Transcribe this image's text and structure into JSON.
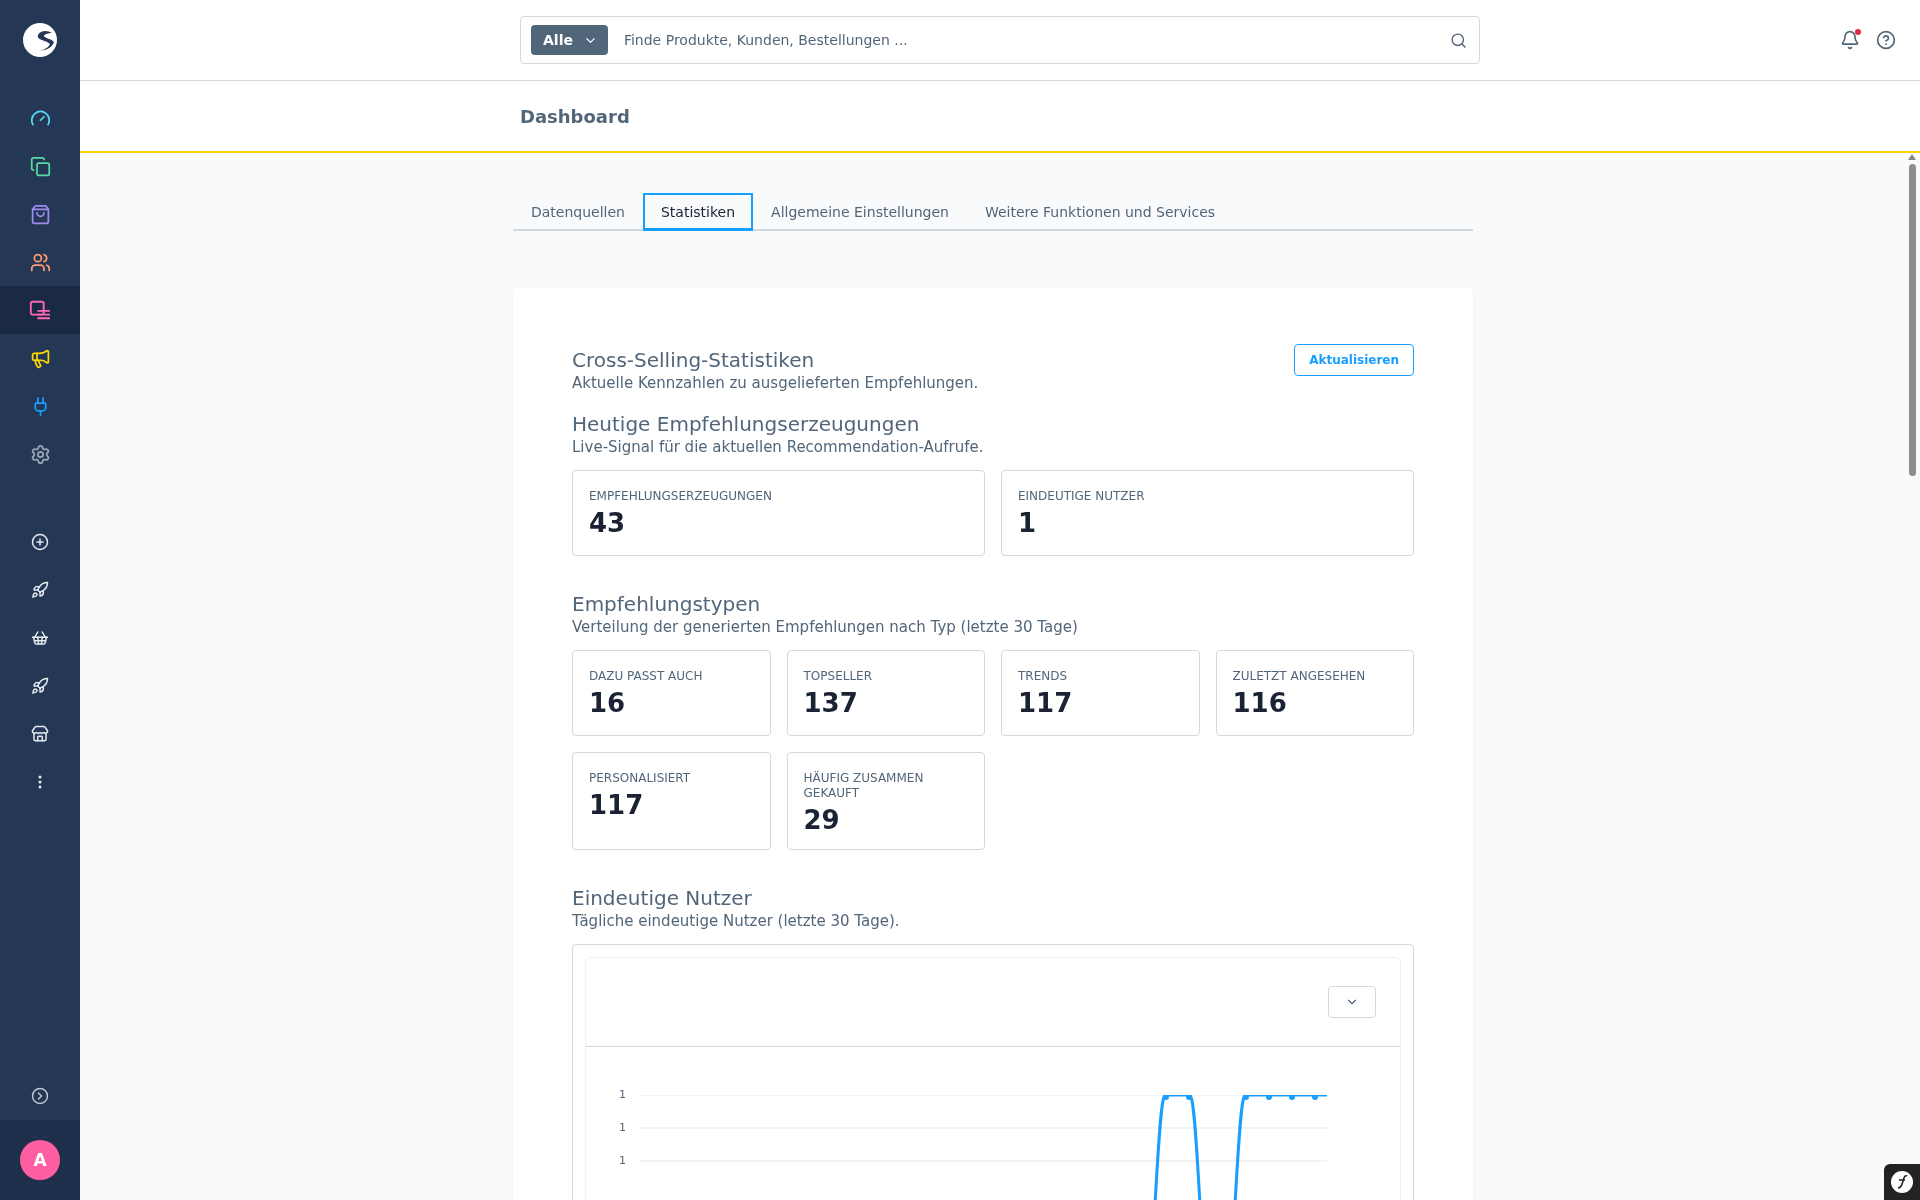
{
  "sidebar": {
    "nav": [
      {
        "color": "#57d9f8",
        "selected": false
      },
      {
        "color": "#57d9a3",
        "selected": false
      },
      {
        "color": "#9e8cf4",
        "selected": false
      },
      {
        "color": "#ff9a73",
        "selected": false
      },
      {
        "color": "#ff68b4",
        "selected": true
      },
      {
        "color": "#ffd700",
        "selected": false
      },
      {
        "color": "#189eff",
        "selected": false
      },
      {
        "color": "#9aa8b5",
        "selected": false
      }
    ],
    "extensions": [
      {
        "selected": false
      },
      {
        "selected": false
      },
      {
        "selected": false
      },
      {
        "selected": false
      },
      {
        "selected": false
      },
      {
        "selected": false
      }
    ],
    "avatar": "A"
  },
  "search": {
    "scope": "Alle",
    "placeholder": "Finde Produkte, Kunden, Bestellungen ..."
  },
  "page_title": "Dashboard",
  "tabs": [
    {
      "label": "Datenquellen",
      "selected": false
    },
    {
      "label": "Statistiken",
      "selected": true
    },
    {
      "label": "Allgemeine Einstellungen",
      "selected": false
    },
    {
      "label": "Weitere Funktionen und Services",
      "selected": false
    }
  ],
  "panel": {
    "title": "Cross-Selling-Statistiken",
    "subtitle": "Aktuelle Kennzahlen zu ausgelieferten Empfehlungen.",
    "refresh_button": "Aktualisieren",
    "sections": [
      {
        "title": "Heutige Empfehlungserzeugungen",
        "subtitle": "Live-Signal für die aktuellen Recommendation-Aufrufe.",
        "cards": [
          {
            "label": "EMPFEHLUNGSERZEUGUNGEN",
            "value": "43"
          },
          {
            "label": "EINDEUTIGE NUTZER",
            "value": "1"
          }
        ]
      },
      {
        "title": "Empfehlungstypen",
        "subtitle": "Verteilung der generierten Empfehlungen nach Typ (letzte 30 Tage)",
        "cards": [
          {
            "label": "DAZU PASST AUCH",
            "value": "16"
          },
          {
            "label": "TOPSELLER",
            "value": "137"
          },
          {
            "label": "TRENDS",
            "value": "117"
          },
          {
            "label": "ZULETZT ANGESEHEN",
            "value": "116"
          },
          {
            "label": "PERSONALISIERT",
            "value": "117"
          },
          {
            "label": "HÄUFIG ZUSAMMEN GEKAUFT",
            "value": "29"
          }
        ]
      }
    ],
    "chart_section": {
      "title": "Eindeutige Nutzer",
      "subtitle": "Tägliche eindeutige Nutzer (letzte 30 Tage).",
      "y_labels": [
        "1",
        "1",
        "1"
      ]
    }
  }
}
